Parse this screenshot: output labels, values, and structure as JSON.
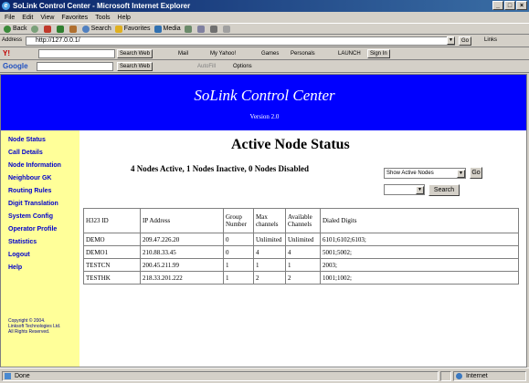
{
  "window": {
    "title": "SoLink Control Center - Microsoft Internet Explorer",
    "controls": [
      "_",
      "□",
      "×"
    ]
  },
  "menu": [
    "File",
    "Edit",
    "View",
    "Favorites",
    "Tools",
    "Help"
  ],
  "toolbar": {
    "back": "Back",
    "search": "Search",
    "favorites": "Favorites",
    "media": "Media"
  },
  "address": {
    "label": "Address",
    "url": "http://127.0.0.1/",
    "go": "Go",
    "links": "Links"
  },
  "yahoo_bar": {
    "search_web": "Search Web",
    "mail": "Mail",
    "my_yahoo": "My Yahoo!",
    "games": "Games",
    "personals": "Personals",
    "launch": "LAUNCH",
    "sign_in": "Sign In"
  },
  "google_bar": {
    "label": "Google",
    "search_web": "Search Web",
    "autofill": "AutoFill",
    "options": "Options"
  },
  "banner": {
    "title": "SoLink Control Center",
    "version": "Version 2.0"
  },
  "nav": [
    "Node Status",
    "Call Details",
    "Node Information",
    "Neighbour GK",
    "Routing Rules",
    "Digit Translation",
    "System Config",
    "Operator Profile",
    "Statistics",
    "Logout",
    "Help"
  ],
  "copyright": [
    "Copyright © 2004.",
    "Linksoft Technologies Ltd.",
    "All Rights Reserved."
  ],
  "page": {
    "heading": "Active Node Status",
    "summary": "4 Nodes Active, 1 Nodes Inactive, 0 Nodes Disabled",
    "filter_select": "Show Active Nodes",
    "go_button": "Go",
    "search_select": "",
    "search_button": "Search"
  },
  "table": {
    "headers": [
      "H323 ID",
      "IP Address",
      "Group Number",
      "Max channels",
      "Available Channels",
      "Dialed Digits"
    ],
    "rows": [
      [
        "DEMO",
        "209.47.226.20",
        "0",
        "Unlimited",
        "Unlimited",
        "6101;6102;6103;"
      ],
      [
        "DEMO1",
        "210.88.33.45",
        "0",
        "4",
        "4",
        "5001;5002;"
      ],
      [
        "TESTCN",
        "200.45.211.99",
        "1",
        "1",
        "1",
        "2003;"
      ],
      [
        "TESTHK",
        "218.33.201.222",
        "1",
        "2",
        "2",
        "1001;1002;"
      ]
    ]
  },
  "status": {
    "left": "Done",
    "zone": "Internet"
  },
  "colors": {
    "banner": "#0000ff",
    "sidebar": "#ffff99",
    "nav_link": "#0000cc",
    "titlebar": "#0a246a"
  }
}
